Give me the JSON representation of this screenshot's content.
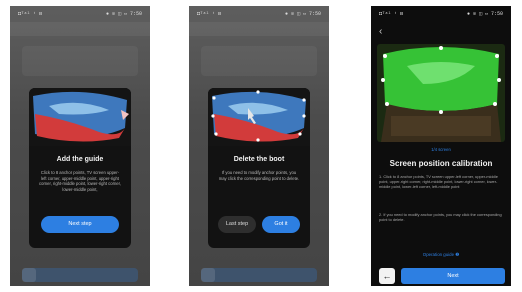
{
  "colors": {
    "accent": "#2d7fe2",
    "modal_bg": "#121212",
    "screen_bg": "#0d0d0d"
  },
  "phone1": {
    "statusbar_left": "◘ᵀᵃˡ ᵗ ⊟",
    "statusbar_right": "● ⊙ ◫ ▭ 7:50",
    "modal": {
      "title": "Add the guide",
      "body": "Click to 8 anchor points, TV screen upper-left corner, upper-middle point, upper-right corner, right-middle point, lower-right corner, lower-middle point,",
      "button": "Next step"
    }
  },
  "phone2": {
    "statusbar_left": "◘ᵀᵃˡ ᵗ ⊟",
    "statusbar_right": "● ⊙ ◫ ▭ 7:50",
    "modal": {
      "title": "Delete the boot",
      "body": "If you need to modify anchor points, you may click the corresponding point to delete.",
      "left_button": "Last step",
      "right_button": "Got it"
    }
  },
  "phone3": {
    "statusbar_left": "◘ᵀᵃˡ ᵗ ⊟",
    "statusbar_right": "● ⊙ ◫ ▭ 7:50",
    "back_icon": "chevron-left-icon",
    "steps_label": "1/4 screen",
    "title": "Screen position calibration",
    "instruction_1": "1. Click to 8 anchor points, TV screen upper-left corner, upper-middle point, upper-right corner, right-middle point, lower-right corner, lower-middle point, lower-left corner, left-middle point",
    "instruction_2": "2. If you need to modify anchor points, you may click the corresponding point to delete.",
    "guide_link": "Operation guide ❷",
    "back_button_icon": "arrow-left-icon",
    "next_button": "Next"
  }
}
